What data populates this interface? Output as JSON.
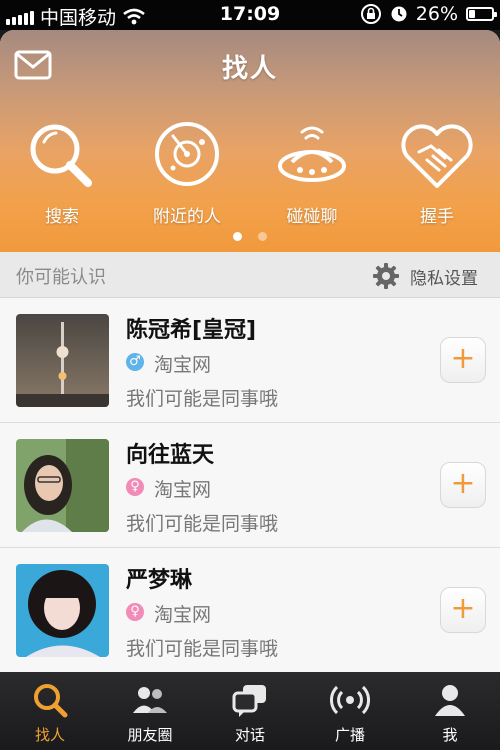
{
  "status_bar": {
    "carrier": "中国移动",
    "time": "17:09",
    "battery_percent": 26
  },
  "header": {
    "title": "找人",
    "actions": [
      {
        "label": "搜索",
        "icon": "search-icon"
      },
      {
        "label": "附近的人",
        "icon": "radar-icon"
      },
      {
        "label": "碰碰聊",
        "icon": "bump-icon"
      },
      {
        "label": "握手",
        "icon": "handshake-heart-icon"
      }
    ],
    "page_indicator": {
      "pages": 2,
      "current": 1
    }
  },
  "section": {
    "title": "你可能认识",
    "privacy_label": "隐私设置"
  },
  "people": [
    {
      "name": "陈冠希[皇冠]",
      "gender": "male",
      "company": "淘宝网",
      "note": "我们可能是同事哦"
    },
    {
      "name": "向往蓝天",
      "gender": "female",
      "company": "淘宝网",
      "note": "我们可能是同事哦"
    },
    {
      "name": "严梦琳",
      "gender": "female",
      "company": "淘宝网",
      "note": "我们可能是同事哦"
    }
  ],
  "add_label": "+",
  "tabs": [
    {
      "label": "找人",
      "icon": "search-icon",
      "active": true
    },
    {
      "label": "朋友圈",
      "icon": "friends-icon",
      "active": false
    },
    {
      "label": "对话",
      "icon": "chat-icon",
      "active": false
    },
    {
      "label": "广播",
      "icon": "broadcast-icon",
      "active": false
    },
    {
      "label": "我",
      "icon": "user-icon",
      "active": false
    }
  ],
  "colors": {
    "accent": "#f19a3c",
    "male": "#5fb3e8",
    "female": "#f08cb7"
  }
}
